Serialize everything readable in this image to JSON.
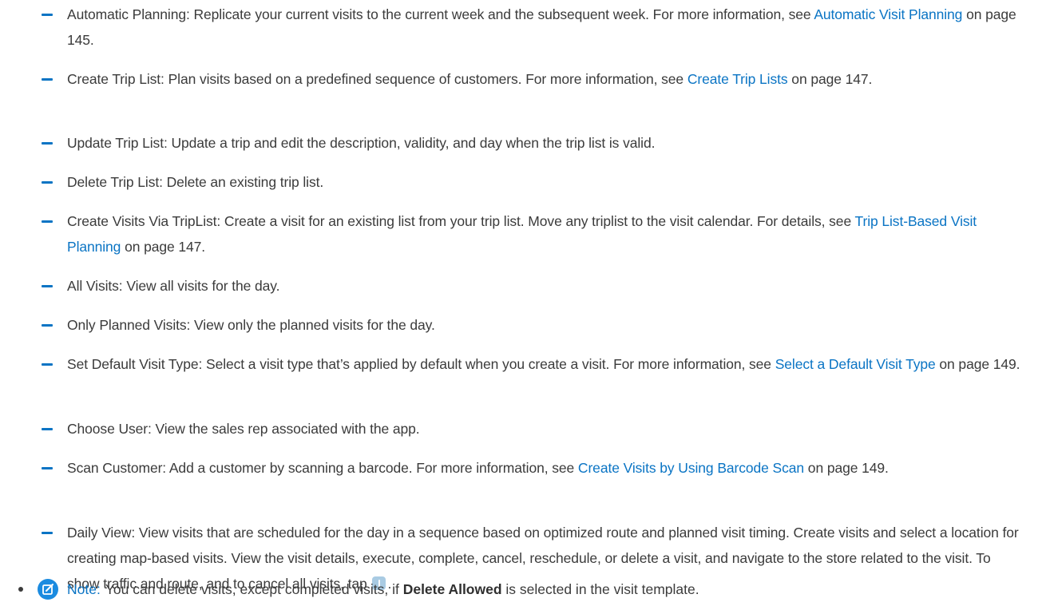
{
  "items": [
    {
      "pre": "Automatic Planning: Replicate your current visits to the current week and the subsequent week. For more information, see ",
      "link": "Automatic Visit Planning",
      "post": " on page 145."
    },
    {
      "pre": "Create Trip List: Plan visits based on a predefined sequence of customers. For more information, see ",
      "link": "Create Trip Lists",
      "post": " on page 147."
    },
    {
      "pre": "Update Trip List: Update a trip and edit the description, validity, and day when the trip list is valid.",
      "link": "",
      "post": ""
    },
    {
      "pre": "Delete Trip List: Delete an existing trip list.",
      "link": "",
      "post": ""
    },
    {
      "pre": "Create Visits Via TripList: Create a visit for an existing list from your trip list. Move any triplist to the visit calendar. For details, see ",
      "link": "Trip List-Based Visit Planning",
      "post": " on page 147."
    },
    {
      "pre": "All Visits: View all visits for the day.",
      "link": "",
      "post": ""
    },
    {
      "pre": "Only Planned Visits: View only the planned visits for the day.",
      "link": "",
      "post": ""
    },
    {
      "pre": "Set Default Visit Type: Select a visit type that’s applied by default when you create a visit. For more information, see ",
      "link": "Select a Default Visit Type",
      "post": " on page 149."
    },
    {
      "pre": "Choose User: View the sales rep associated with the app.",
      "link": "",
      "post": ""
    },
    {
      "pre": "Scan Customer: Add a customer by scanning a barcode. For more information, see ",
      "link": "Create Visits by Using Barcode Scan",
      "post": " on page 149."
    },
    {
      "pre": "Daily View: View visits that are scheduled for the day in a sequence based on optimized route and planned visit timing. Create visits and select a location for creating map-based visits. View the visit details, execute, complete, cancel, reschedule, or delete a visit, and navigate to the store related to the visit. To show traffic and route, and to cancel all visits, tap ",
      "link": "",
      "post": "."
    }
  ],
  "note": {
    "label": "Note:",
    "pre": "You can delete visits, except completed visits, if ",
    "bold": "Delete Allowed",
    "post": " is selected in the visit template."
  },
  "colors": {
    "link": "#0a74c4",
    "dash": "#0a74c4",
    "note_icon": "#1b8be0",
    "text": "#3b3b3b"
  },
  "icons": {
    "daily_view_tap": "info-icon",
    "note": "edit-note-icon"
  }
}
